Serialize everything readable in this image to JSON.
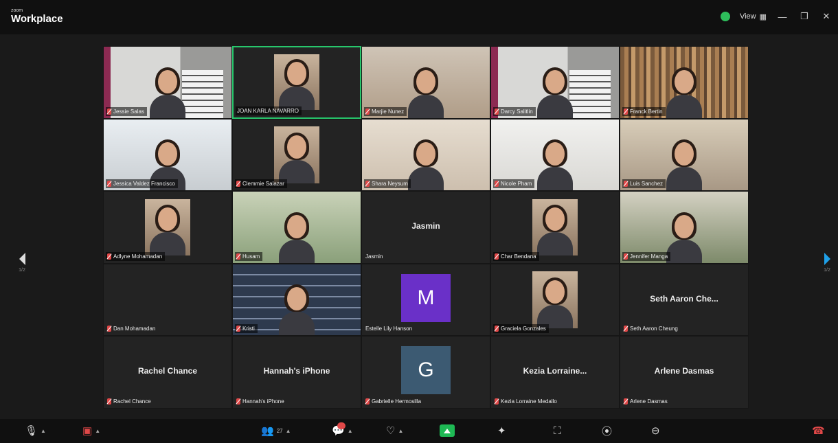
{
  "titlebar": {
    "brand_small": "zoom",
    "brand_big": "Workplace",
    "view_label": "View",
    "shield_color": "#2ebd5b"
  },
  "navigation": {
    "prev_page": "1/2",
    "next_page": "1/2"
  },
  "participants": [
    {
      "name": "Jessie Salas",
      "muted": true,
      "style": "office"
    },
    {
      "name": "JOAN KARLA NAVARRO",
      "muted": false,
      "style": "dark-photo",
      "active": true
    },
    {
      "name": "Marjie Nunez",
      "muted": true,
      "style": "warm"
    },
    {
      "name": "Darcy Salitlin",
      "muted": true,
      "style": "office"
    },
    {
      "name": "Franck Bertin",
      "muted": true,
      "style": "books"
    },
    {
      "name": "Jessica Valdez Francisco",
      "muted": true,
      "style": "kitchen"
    },
    {
      "name": "Clemmie Salazar",
      "muted": true,
      "style": "dark-photo"
    },
    {
      "name": "Shara Neysum",
      "muted": true,
      "style": "cream"
    },
    {
      "name": "Nicole Pham",
      "muted": true,
      "style": "white"
    },
    {
      "name": "Luis Sanchez",
      "muted": true,
      "style": "lamp"
    },
    {
      "name": "Adlyne Mohamadan",
      "muted": true,
      "style": "dark-photo"
    },
    {
      "name": "Husam",
      "muted": true,
      "style": "garden"
    },
    {
      "name": "Jasmin",
      "muted": false,
      "style": "name-only",
      "display": "Jasmin"
    },
    {
      "name": "Char Bendana",
      "muted": true,
      "style": "dark-photo"
    },
    {
      "name": "Jennifer Manga",
      "muted": true,
      "style": "plant"
    },
    {
      "name": "Dan Mohamadan",
      "muted": true,
      "style": "blank"
    },
    {
      "name": "Kristi",
      "muted": true,
      "style": "shelf"
    },
    {
      "name": "Estelle Lily Hanson",
      "muted": false,
      "style": "avatar",
      "initial": "M",
      "avatar_color": "#6a30c8"
    },
    {
      "name": "Graciela Gonzales",
      "muted": true,
      "style": "dark-photo"
    },
    {
      "name": "Seth Aaron Cheung",
      "muted": true,
      "style": "name-only",
      "display": "Seth Aaron Che..."
    },
    {
      "name": "Rachel Chance",
      "muted": true,
      "style": "name-only",
      "display": "Rachel Chance"
    },
    {
      "name": "Hannah's iPhone",
      "muted": true,
      "style": "name-only",
      "display": "Hannah's iPhone"
    },
    {
      "name": "Gabrielle Hermosilla",
      "muted": true,
      "style": "avatar",
      "initial": "G",
      "avatar_color": "#3c5a72"
    },
    {
      "name": "Kezia Lorraine Medallo",
      "muted": true,
      "style": "name-only",
      "display": "Kezia Lorraine..."
    },
    {
      "name": "Arlene Dasmas",
      "muted": true,
      "style": "name-only",
      "display": "Arlene Dasmas"
    }
  ],
  "toolbar": {
    "participants_count": "27",
    "accent_color": "#1eb954",
    "mute_color": "#e04848"
  }
}
